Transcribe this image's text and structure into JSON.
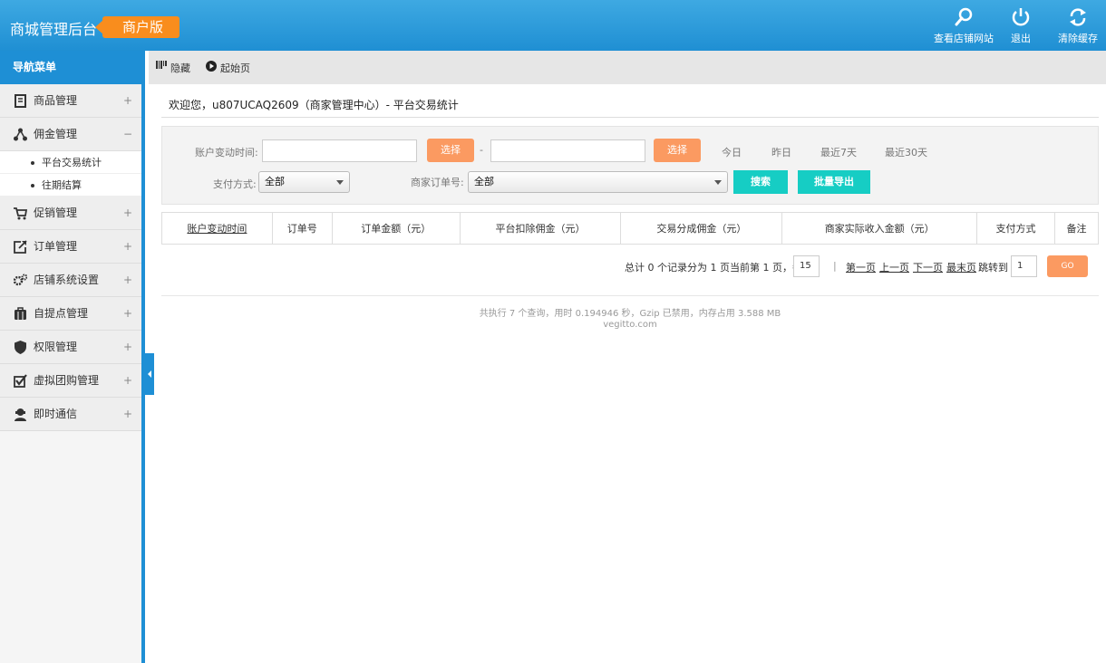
{
  "header": {
    "title": "商城管理后台",
    "edition": "商户版",
    "buttons": [
      {
        "label": "查看店铺网站",
        "icon": "search-icon"
      },
      {
        "label": "退出",
        "icon": "power-icon"
      },
      {
        "label": "清除缓存",
        "icon": "refresh-icon"
      }
    ]
  },
  "sidebar": {
    "title": "导航菜单",
    "items": [
      {
        "label": "商品管理",
        "icon": "product-icon",
        "toggle": "+"
      },
      {
        "label": "佣金管理",
        "icon": "share-icon",
        "toggle": "−"
      },
      {
        "label": "促销管理",
        "icon": "cart-icon",
        "toggle": "+"
      },
      {
        "label": "订单管理",
        "icon": "order-icon",
        "toggle": "+"
      },
      {
        "label": "店铺系统设置",
        "icon": "gears-icon",
        "toggle": "+"
      },
      {
        "label": "自提点管理",
        "icon": "briefcase-icon",
        "toggle": "+"
      },
      {
        "label": "权限管理",
        "icon": "shield-icon",
        "toggle": "+"
      },
      {
        "label": "虚拟团购管理",
        "icon": "checkbox-icon",
        "toggle": "+"
      },
      {
        "label": "即时通信",
        "icon": "user-chat-icon",
        "toggle": "+"
      }
    ],
    "subitems": [
      "平台交易统计",
      "往期结算"
    ]
  },
  "toolbar": {
    "hide": "隐藏",
    "home": "起始页"
  },
  "welcome": "欢迎您，u807UCAQ2609（商家管理中心）- 平台交易统计",
  "filter": {
    "time_label": "账户变动时间:",
    "select_btn": "选择",
    "dash": "-",
    "quick": [
      "今日",
      "昨日",
      "最近7天",
      "最近30天"
    ],
    "pay_label": "支付方式:",
    "pay_value": "全部",
    "order_label": "商家订单号:",
    "order_value": "全部",
    "search_btn": "搜索",
    "export_btn": "批量导出"
  },
  "table": {
    "columns": [
      "账户变动时间",
      "订单号",
      "订单金额（元）",
      "平台扣除佣金（元）",
      "交易分成佣金（元）",
      "商家实际收入金额（元）",
      "支付方式",
      "备注"
    ]
  },
  "pager": {
    "summary": "总计 0 个记录分为 1 页当前第 1 页，每页",
    "per_page": "15",
    "sep": "|",
    "first": "第一页",
    "prev": "上一页",
    "next": "下一页",
    "last": "最末页",
    "jump": "跳转到",
    "page": "1",
    "go": "GO"
  },
  "footer": {
    "stats": "共执行 7 个查询，用时 0.194946 秒，Gzip 已禁用，内存占用 3.588 MB",
    "site": "vegitto.com"
  }
}
